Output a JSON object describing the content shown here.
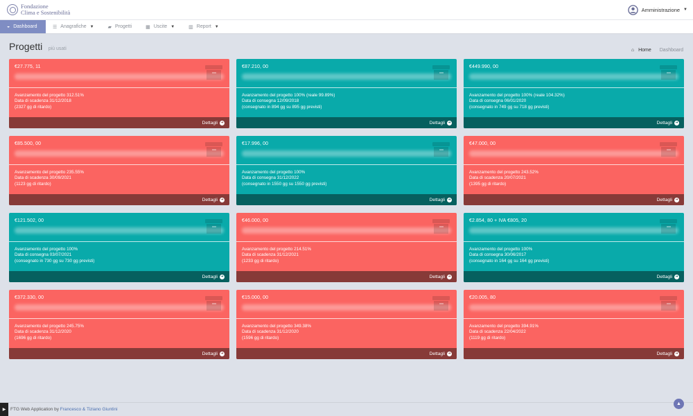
{
  "header": {
    "brand_line1": "Fondazione",
    "brand_line2": "Clima e Sostenibilità",
    "user_label": "Amministrazione"
  },
  "nav": {
    "items": [
      {
        "label": "Dashboard",
        "icon": "dashboard-icon"
      },
      {
        "label": "Anagrafiche",
        "icon": "list-icon"
      },
      {
        "label": "Progetti",
        "icon": "folder-icon"
      },
      {
        "label": "Uscite",
        "icon": "table-icon"
      },
      {
        "label": "Report",
        "icon": "chart-icon"
      }
    ]
  },
  "page": {
    "title": "Progetti",
    "subtitle": "più usati",
    "breadcrumb_home": "Home",
    "breadcrumb_current": "Dashboard"
  },
  "colors": {
    "red": "#fb6461",
    "teal": "#09aaaa",
    "nav_active": "#7f8dc3"
  },
  "cards": [
    {
      "color": "red",
      "amount": "€27.775, 11",
      "line1": "Avanzamento del progetto 312.51%",
      "line2": "Data di scadenza 31/12/2018",
      "line3": "(2327 gg di ritardo)",
      "footer": "Dettagli"
    },
    {
      "color": "teal",
      "amount": "€87.210, 00",
      "line1": "Avanzamento del progetto 100% (reale 99.89%)",
      "line2": "Data di consegna 12/09/2018",
      "line3": "(consegnato in 894 gg su 895 gg previsti)",
      "footer": "Dettagli"
    },
    {
      "color": "teal",
      "amount": "€449.990, 00",
      "line1": "Avanzamento del progetto 100% (reale 104.32%)",
      "line2": "Data di consegna 06/01/2020",
      "line3": "(consegnato in 749 gg su 718 gg previsti)",
      "footer": "Dettagli"
    },
    {
      "color": "red",
      "amount": "€85.500, 00",
      "line1": "Avanzamento del progetto 235.55%",
      "line2": "Data di scadenza 30/09/2021",
      "line3": "(1123 gg di ritardo)",
      "footer": "Dettagli"
    },
    {
      "color": "teal",
      "amount": "€17.996, 00",
      "line1": "Avanzamento del progetto 100%",
      "line2": "Data di consegna 31/12/2022",
      "line3": "(consegnato in 1550 gg su 1550 gg previsti)",
      "footer": "Dettagli"
    },
    {
      "color": "red",
      "amount": "€47.000, 00",
      "line1": "Avanzamento del progetto 243.52%",
      "line2": "Data di scadenza 20/07/2021",
      "line3": "(1395 gg di ritardo)",
      "footer": "Dettagli"
    },
    {
      "color": "teal",
      "amount": "€121.502, 00",
      "line1": "Avanzamento del progetto 100%",
      "line2": "Data di consegna 03/07/2021",
      "line3": "(consegnato in 730 gg su 730 gg previsti)",
      "footer": "Dettagli"
    },
    {
      "color": "red",
      "amount": "€46.000, 00",
      "line1": "Avanzamento del progetto 214.51%",
      "line2": "Data di scadenza 31/12/2021",
      "line3": "(1233 gg di ritardo)",
      "footer": "Dettagli"
    },
    {
      "color": "teal",
      "amount": "€2.854, 80 + IVA €805, 20",
      "line1": "Avanzamento del progetto 100%",
      "line2": "Data di consegna 30/06/2017",
      "line3": "(consegnato in 164 gg su 164 gg previsti)",
      "footer": "Dettagli"
    },
    {
      "color": "red",
      "amount": "€372.330, 00",
      "line1": "Avanzamento del progetto 245.75%",
      "line2": "Data di scadenza 31/12/2020",
      "line3": "(1696 gg di ritardo)",
      "footer": "Dettagli"
    },
    {
      "color": "red",
      "amount": "€15.000, 00",
      "line1": "Avanzamento del progetto 349.38%",
      "line2": "Data di scadenza 31/12/2020",
      "line3": "(1596 gg di ritardo)",
      "footer": "Dettagli"
    },
    {
      "color": "red",
      "amount": "€20.005, 80",
      "line1": "Avanzamento del progetto 394.91%",
      "line2": "Data di scadenza 22/04/2022",
      "line3": "(1119 gg di ritardo)",
      "footer": "Dettagli"
    }
  ],
  "footer": {
    "prefix": "FTG Web Application by",
    "authors": "Francesco & Tiziano Giuntini"
  }
}
